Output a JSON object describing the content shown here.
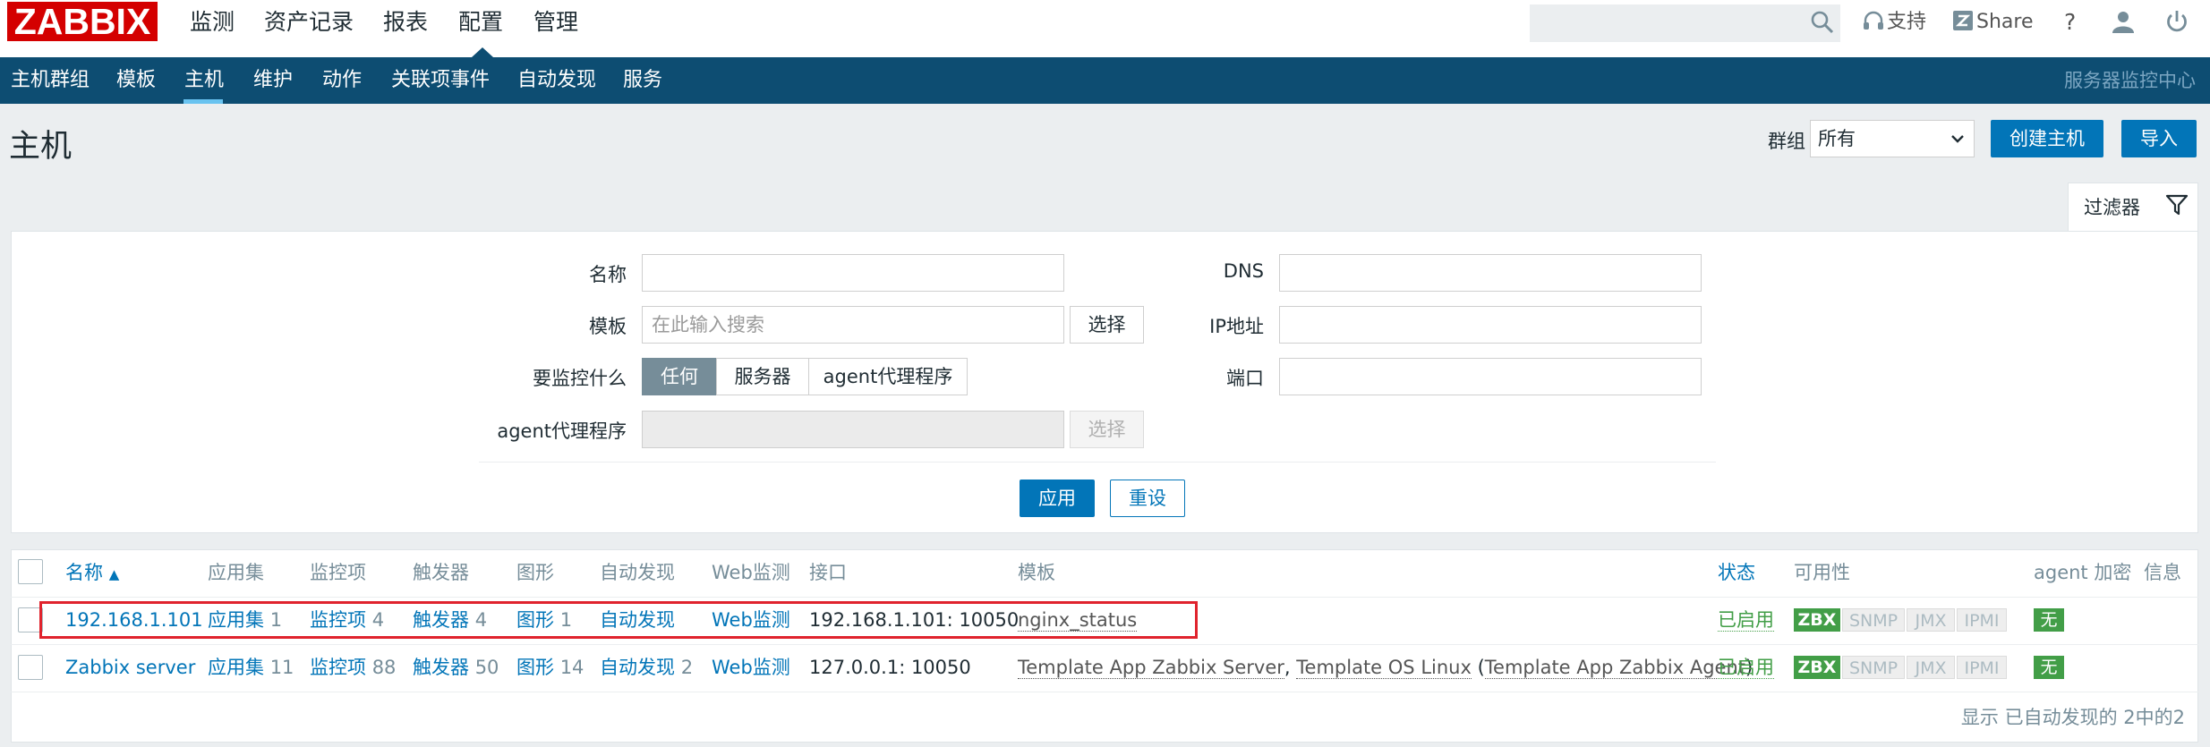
{
  "top_nav": {
    "logo": "ZABBIX",
    "menus": [
      "监测",
      "资产记录",
      "报表",
      "配置",
      "管理"
    ],
    "selected": "配置",
    "support": "支持",
    "share": "Share",
    "help": "?"
  },
  "sub_nav": {
    "items": [
      "主机群组",
      "模板",
      "主机",
      "维护",
      "动作",
      "关联项事件",
      "自动发现",
      "服务"
    ],
    "selected": "主机",
    "right_label": "服务器监控中心"
  },
  "header": {
    "title": "主机",
    "group_label": "群组",
    "group_value": "所有",
    "create_button": "创建主机",
    "import_button": "导入"
  },
  "filter": {
    "tab_label": "过滤器",
    "name_label": "名称",
    "name_value": "",
    "template_label": "模板",
    "template_placeholder": "在此输入搜索",
    "select_label": "选择",
    "monitor_label": "要监控什么",
    "monitor_options": [
      "任何",
      "服务器",
      "agent代理程序"
    ],
    "monitor_selected": "任何",
    "proxy_label": "agent代理程序",
    "proxy_select_label": "选择",
    "dns_label": "DNS",
    "dns_value": "",
    "ip_label": "IP地址",
    "ip_value": "",
    "port_label": "端口",
    "port_value": "",
    "apply": "应用",
    "reset": "重设"
  },
  "table": {
    "headers": {
      "name": "名称",
      "applications": "应用集",
      "items": "监控项",
      "triggers": "触发器",
      "graphs": "图形",
      "discovery": "自动发现",
      "web": "Web监测",
      "interface": "接口",
      "templates": "模板",
      "status": "状态",
      "availability": "可用性",
      "encryption": "agent 加密",
      "info": "信息"
    },
    "sort_arrow": "▲",
    "rows": [
      {
        "name": "192.168.1.101",
        "applications": "应用集",
        "applications_count": "1",
        "items": "监控项",
        "items_count": "4",
        "triggers": "触发器",
        "triggers_count": "4",
        "graphs": "图形",
        "graphs_count": "1",
        "discovery": "自动发现",
        "discovery_count": "",
        "web": "Web监测",
        "interface": "192.168.1.101: 10050",
        "templates": [
          "nginx_status"
        ],
        "status": "已启用",
        "availability": [
          "ZBX",
          "SNMP",
          "JMX",
          "IPMI"
        ],
        "encryption": "无",
        "highlighted": true
      },
      {
        "name": "Zabbix server",
        "applications": "应用集",
        "applications_count": "11",
        "items": "监控项",
        "items_count": "88",
        "triggers": "触发器",
        "triggers_count": "50",
        "graphs": "图形",
        "graphs_count": "14",
        "discovery": "自动发现",
        "discovery_count": "2",
        "web": "Web监测",
        "interface": "127.0.0.1: 10050",
        "templates": [
          "Template App Zabbix Server",
          "Template OS Linux",
          "Template App Zabbix Agent"
        ],
        "template_sep": ", ",
        "template_paren_open": " (",
        "template_paren_close": ")",
        "status": "已启用",
        "availability": [
          "ZBX",
          "SNMP",
          "JMX",
          "IPMI"
        ],
        "encryption": "无",
        "highlighted": false
      }
    ],
    "summary": "显示 已自动发现的 2中的2"
  },
  "colors": {
    "brand_red": "#d40000",
    "subnav_bg": "#0d4d72",
    "link_blue": "#0275b8",
    "status_green": "#429e47",
    "highlight_red": "#e0232d"
  }
}
